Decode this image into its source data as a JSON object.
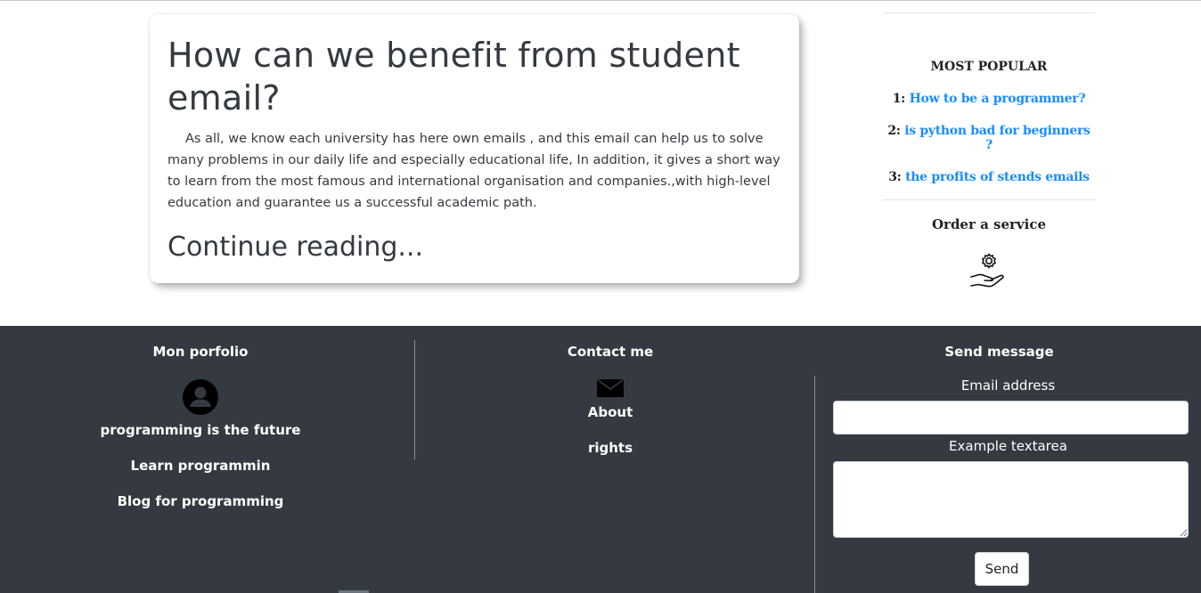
{
  "article": {
    "title": "How can we benefit from student email?",
    "body": "As all, we know each university has here own emails , and this email can help us to solve many problems in our daily life and especially educational life, In addition, it gives a short way to learn from the most famous and international organisation and companies.,with high-level education and guarantee us a successful academic path.",
    "continue_label": "Continue reading..."
  },
  "sidebar": {
    "popular_title": "MOST POPULAR",
    "popular_items": [
      {
        "number": "1:",
        "label": "How to be a programmer?"
      },
      {
        "number": "2:",
        "label": "is python bad for beginners ?"
      },
      {
        "number": "3:",
        "label": "the profits of stends emails"
      }
    ],
    "order_title": "Order a service",
    "order_icon": "service-hand-gear-icon"
  },
  "footer": {
    "portfolio": {
      "title": "Mon porfolio",
      "icon": "user-avatar-icon",
      "links": [
        "programming is the future",
        "Learn programmin",
        "Blog for programming"
      ]
    },
    "contact": {
      "title": "Contact me",
      "icon": "envelope-icon",
      "links": [
        "About",
        "rights"
      ]
    },
    "message": {
      "title": "Send message",
      "email_label": "Email address",
      "email_value": "",
      "textarea_label": "Example textarea",
      "textarea_value": "",
      "send_label": "Send"
    }
  },
  "colors": {
    "footer_bg": "#343a40",
    "link_blue": "#1a8cff",
    "text_dark": "#343a40"
  }
}
